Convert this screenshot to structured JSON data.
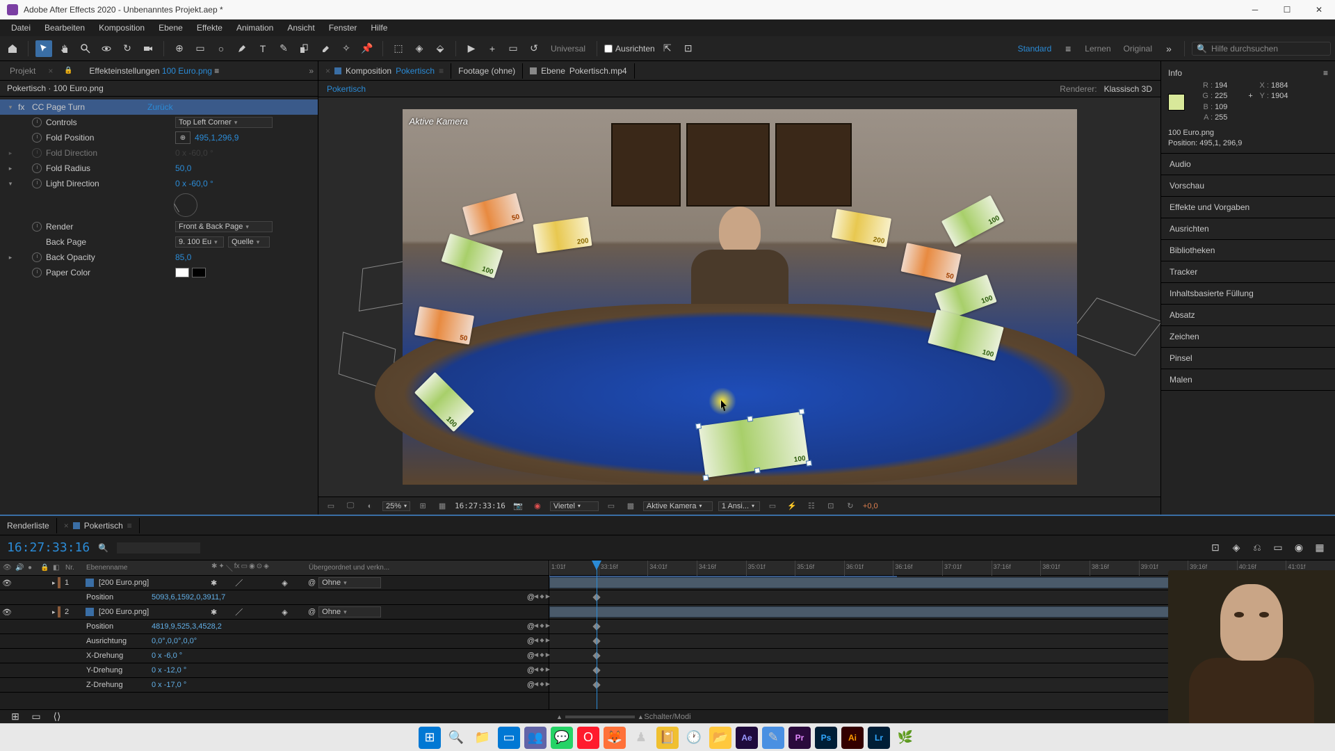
{
  "titlebar": {
    "text": "Adobe After Effects 2020 - Unbenanntes Projekt.aep *"
  },
  "menubar": [
    "Datei",
    "Bearbeiten",
    "Komposition",
    "Ebene",
    "Effekte",
    "Animation",
    "Ansicht",
    "Fenster",
    "Hilfe"
  ],
  "toolbar": {
    "universal": "Universal",
    "ausrichten": "Ausrichten",
    "workspace_standard": "Standard",
    "workspace_lernen": "Lernen",
    "workspace_original": "Original",
    "search_placeholder": "Hilfe durchsuchen"
  },
  "left_panel": {
    "tab_projekt": "Projekt",
    "tab_effect_label": "Effekteinstellungen",
    "tab_effect_item": "100 Euro.png",
    "breadcrumb": "Pokertisch · 100 Euro.png",
    "effect_name": "CC Page Turn",
    "reset": "Zurück",
    "controls": "Controls",
    "controls_val": "Top Left Corner",
    "fold_position": "Fold Position",
    "fold_position_val": "495,1,296,9",
    "fold_direction": "Fold Direction",
    "fold_direction_val": "0 x -60,0 °",
    "fold_radius": "Fold Radius",
    "fold_radius_val": "50,0",
    "light_direction": "Light Direction",
    "light_direction_val": "0 x -60,0 °",
    "render": "Render",
    "render_val": "Front & Back Page",
    "back_page": "Back Page",
    "back_page_layer": "9. 100 Eu",
    "back_page_source": "Quelle",
    "back_opacity": "Back Opacity",
    "back_opacity_val": "85,0",
    "paper_color": "Paper Color"
  },
  "comp": {
    "tab_komposition": "Komposition",
    "tab_komposition_name": "Pokertisch",
    "tab_footage": "Footage (ohne)",
    "tab_ebene": "Ebene",
    "tab_ebene_name": "Pokertisch.mp4",
    "sub_name": "Pokertisch",
    "renderer_label": "Renderer:",
    "renderer_val": "Klassisch 3D",
    "camera_label": "Aktive Kamera",
    "footer_zoom": "25%",
    "footer_time": "16:27:33:16",
    "footer_res": "Viertel",
    "footer_cam": "Aktive Kamera",
    "footer_views": "1 Ansi...",
    "footer_exposure": "+0,0"
  },
  "right": {
    "info_title": "Info",
    "R": "194",
    "G": "225",
    "B": "109",
    "A": "255",
    "X": "1884",
    "Y": "1904",
    "layer_name": "100 Euro.png",
    "layer_pos": "Position: 495,1, 296,9",
    "sections": [
      "Audio",
      "Vorschau",
      "Effekte und Vorgaben",
      "Ausrichten",
      "Bibliotheken",
      "Tracker",
      "Inhaltsbasierte Füllung",
      "Absatz",
      "Zeichen",
      "Pinsel",
      "Malen"
    ]
  },
  "timeline": {
    "tab_renderliste": "Renderliste",
    "tab_comp": "Pokertisch",
    "timecode": "16:27:33:16",
    "header_nr": "Nr.",
    "header_ebenenname": "Ebenenname",
    "header_parent": "Übergeordnet und verkn...",
    "parent_none": "Ohne",
    "footer_text": "Schalter/Modi",
    "layers": [
      {
        "nr": "1",
        "name": "[200 Euro.png]",
        "props": [
          {
            "label": "Position",
            "value": "5093,6,1592,0,3911,7"
          }
        ]
      },
      {
        "nr": "2",
        "name": "[200 Euro.png]",
        "props": [
          {
            "label": "Position",
            "value": "4819,9,525,3,4528,2"
          },
          {
            "label": "Ausrichtung",
            "value": "0,0°,0,0°,0,0°"
          },
          {
            "label": "X-Drehung",
            "value": "0 x -6,0 °"
          },
          {
            "label": "Y-Drehung",
            "value": "0 x -12,0 °"
          },
          {
            "label": "Z-Drehung",
            "value": "0 x -17,0 °"
          }
        ]
      }
    ],
    "ruler_ticks": [
      "1:01f",
      "33:16f",
      "34:01f",
      "34:16f",
      "35:01f",
      "35:16f",
      "36:01f",
      "36:16f",
      "37:01f",
      "37:16f",
      "38:01f",
      "38:16f",
      "39:01f",
      "39:16f",
      "40:16f",
      "41:01f"
    ]
  },
  "taskbar": [
    "windows",
    "search",
    "explorer",
    "taskview",
    "teams",
    "whatsapp",
    "opera",
    "firefox",
    "chess",
    "evernote",
    "clock",
    "files",
    "ae",
    "app",
    "pr",
    "ps",
    "ai",
    "lr",
    "leaf"
  ]
}
